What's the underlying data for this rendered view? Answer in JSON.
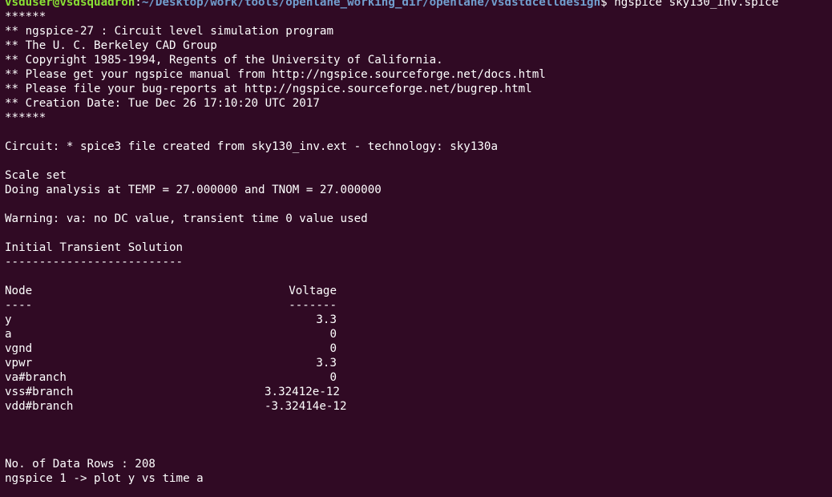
{
  "terminal": {
    "prompt": {
      "user_host": "vsduser@vsdsquadron",
      "colon": ":",
      "path": "~/Desktop/work/tools/openlane_working_dir/openlane/vsdstdcelldesign",
      "symbol": "$ ",
      "command": "ngspice sky130_inv.spice"
    },
    "banner": [
      "******",
      "** ngspice-27 : Circuit level simulation program",
      "** The U. C. Berkeley CAD Group",
      "** Copyright 1985-1994, Regents of the University of California.",
      "** Please get your ngspice manual from http://ngspice.sourceforge.net/docs.html",
      "** Please file your bug-reports at http://ngspice.sourceforge.net/bugrep.html",
      "** Creation Date: Tue Dec 26 17:10:20 UTC 2017",
      "******"
    ],
    "circuit_line": "Circuit: * spice3 file created from sky130_inv.ext - technology: sky130a",
    "scale_line": "Scale set",
    "analysis_line": "Doing analysis at TEMP = 27.000000 and TNOM = 27.000000",
    "warning_line": "Warning: va: no DC value, transient time 0 value used",
    "solution_title": "Initial Transient Solution",
    "solution_rule": "--------------------------",
    "table": {
      "header_node": "Node",
      "header_voltage": "Voltage",
      "rule_node": "----",
      "rule_voltage": "-------",
      "rows": [
        {
          "node": "y",
          "voltage": "3.3"
        },
        {
          "node": "a",
          "voltage": "0"
        },
        {
          "node": "vgnd",
          "voltage": "0"
        },
        {
          "node": "vpwr",
          "voltage": "3.3"
        },
        {
          "node": "va#branch",
          "voltage": "0"
        },
        {
          "node": "vss#branch",
          "voltage": "3.32412e-12"
        },
        {
          "node": "vdd#branch",
          "voltage": "-3.32414e-12"
        }
      ]
    },
    "data_rows_line": "No. of Data Rows : 208",
    "ngspice_prompt": "ngspice 1 -> ",
    "ngspice_command": "plot y vs time a"
  },
  "colors": {
    "background": "#300a24",
    "text": "#ffffff",
    "user_host": "#8ae234",
    "path": "#729fcf"
  }
}
